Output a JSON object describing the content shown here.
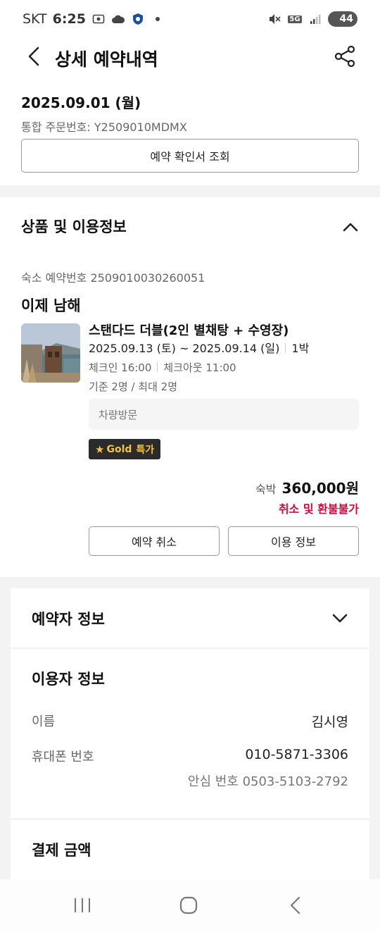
{
  "status_bar": {
    "carrier": "SKT",
    "time": "6:25",
    "network": "5G",
    "battery": "44"
  },
  "header": {
    "title": "상세 예약내역"
  },
  "summary": {
    "date": "2025.09.01 (월)",
    "order_number": "통합 주문번호: Y2509010MDMX",
    "confirm_button": "예약 확인서 조회"
  },
  "product": {
    "section_title": "상품 및 이용정보",
    "stay_reservation_no": "숙소 예약번호 2509010030260051",
    "hotel_name": "이제 남해",
    "room_name": "스탠다드 더블(2인 별채탕 + 수영장)",
    "dates": "2025.09.13 (토) ~ 2025.09.14 (일)",
    "nights": "1박",
    "checkin": "체크인 16:00",
    "checkout": "체크아웃 11:00",
    "capacity": "기준 2명 / 최대 2명",
    "visit_type": "차량방문",
    "badge": {
      "star": "★",
      "brand": "Gold",
      "label": "특가"
    },
    "price_label": "숙박",
    "price": "360,000원",
    "refund_policy": "취소 및 환불불가",
    "cancel_button": "예약 취소",
    "info_button": "이용 정보"
  },
  "booker": {
    "title": "예약자 정보"
  },
  "user": {
    "title": "이용자 정보",
    "name_label": "이름",
    "name_value": "김시영",
    "phone_label": "휴대폰 번호",
    "phone_value": "010-5871-3306",
    "safe_number": "안심 번호 0503-5103-2792"
  },
  "payment": {
    "title": "결제 금액"
  },
  "colors": {
    "accent_red": "#d2083f",
    "badge_bg": "#2b2b2b",
    "badge_gold": "#f0c44c",
    "page_grey": "#f3f3f3"
  }
}
